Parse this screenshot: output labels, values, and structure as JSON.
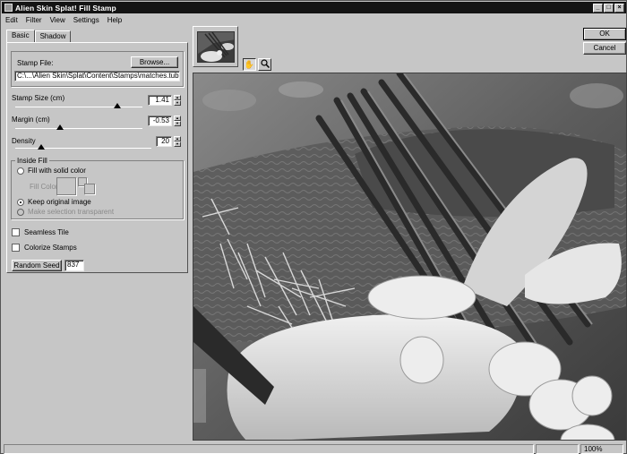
{
  "window": {
    "title": "Alien Skin Splat! Fill Stamp",
    "controls": [
      "_",
      "□",
      "×"
    ]
  },
  "menu": [
    "Edit",
    "Filter",
    "View",
    "Settings",
    "Help"
  ],
  "tabs": [
    "Basic",
    "Shadow"
  ],
  "stamp_file": {
    "label": "Stamp File:",
    "browse_label": "Browse...",
    "path": "C:\\...\\Alien Skin\\Splat\\Content\\Stamps\\matches.tub"
  },
  "stamp_size": {
    "label": "Stamp Size (cm)",
    "value": "1.41"
  },
  "margin": {
    "label": "Margin (cm)",
    "value": "-0.53"
  },
  "density": {
    "label": "Density",
    "value": "20"
  },
  "inside_fill": {
    "title": "Inside Fill",
    "fill_solid": "Fill with solid color",
    "fill_color": "Fill Color:",
    "keep_original": "Keep original image",
    "make_transparent": "Make selection transparent",
    "selected": "Keep original image"
  },
  "seamless_tile": {
    "label": "Seamless Tile",
    "checked": false
  },
  "colorize_stamps": {
    "label": "Colorize Stamps",
    "checked": false
  },
  "random_seed": {
    "label": "Random Seed",
    "value": "837"
  },
  "buttons": {
    "ok": "OK",
    "cancel": "Cancel"
  },
  "tools": {
    "hand": "hand-icon",
    "zoom": "magnifier-icon"
  },
  "status": {
    "zoom": "100%"
  }
}
